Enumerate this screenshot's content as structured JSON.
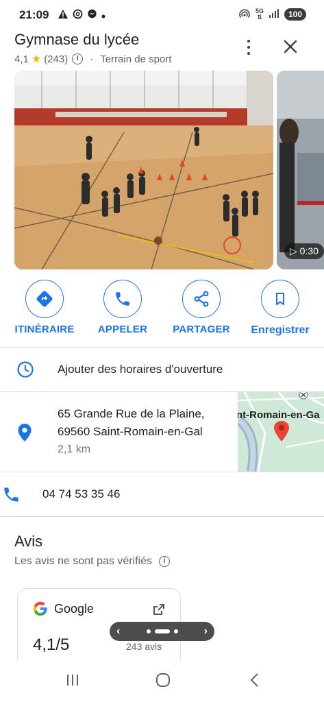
{
  "status_bar": {
    "time": "21:09",
    "battery": "100",
    "left_icons": [
      "warning-icon",
      "threads-icon",
      "messenger-icon",
      "dot-icon"
    ],
    "right_icons": [
      "hotspot-icon",
      "5g-icon",
      "signal-icon"
    ],
    "network": "5G"
  },
  "place": {
    "title": "Gymnase du lycée",
    "rating": "4,1",
    "review_count": "(243)",
    "category": "Terrain de sport"
  },
  "photos": {
    "video_duration": "0:30"
  },
  "actions": [
    {
      "label": "ITINÉRAIRE",
      "icon": "directions-icon"
    },
    {
      "label": "APPELER",
      "icon": "phone-icon"
    },
    {
      "label": "PARTAGER",
      "icon": "share-icon"
    },
    {
      "label": "Enregistrer",
      "icon": "bookmark-icon"
    }
  ],
  "hours": {
    "label": "Ajouter des horaires d'ouverture"
  },
  "address": {
    "line1": "65 Grande Rue de la Plaine,",
    "line2": "69560 Saint-Romain-en-Gal",
    "distance": "2,1 km",
    "map_label": "nt-Romain-en-Ga"
  },
  "phone": {
    "number": "04 74 53 35 46"
  },
  "reviews": {
    "title": "Avis",
    "note": "Les avis ne sont pas vérifiés",
    "card": {
      "brand": "Google",
      "score": "4,1/5",
      "count": "243 avis"
    }
  },
  "colors": {
    "accent": "#1a73e8",
    "star": "#f4b400",
    "pin": "#ea4335"
  }
}
